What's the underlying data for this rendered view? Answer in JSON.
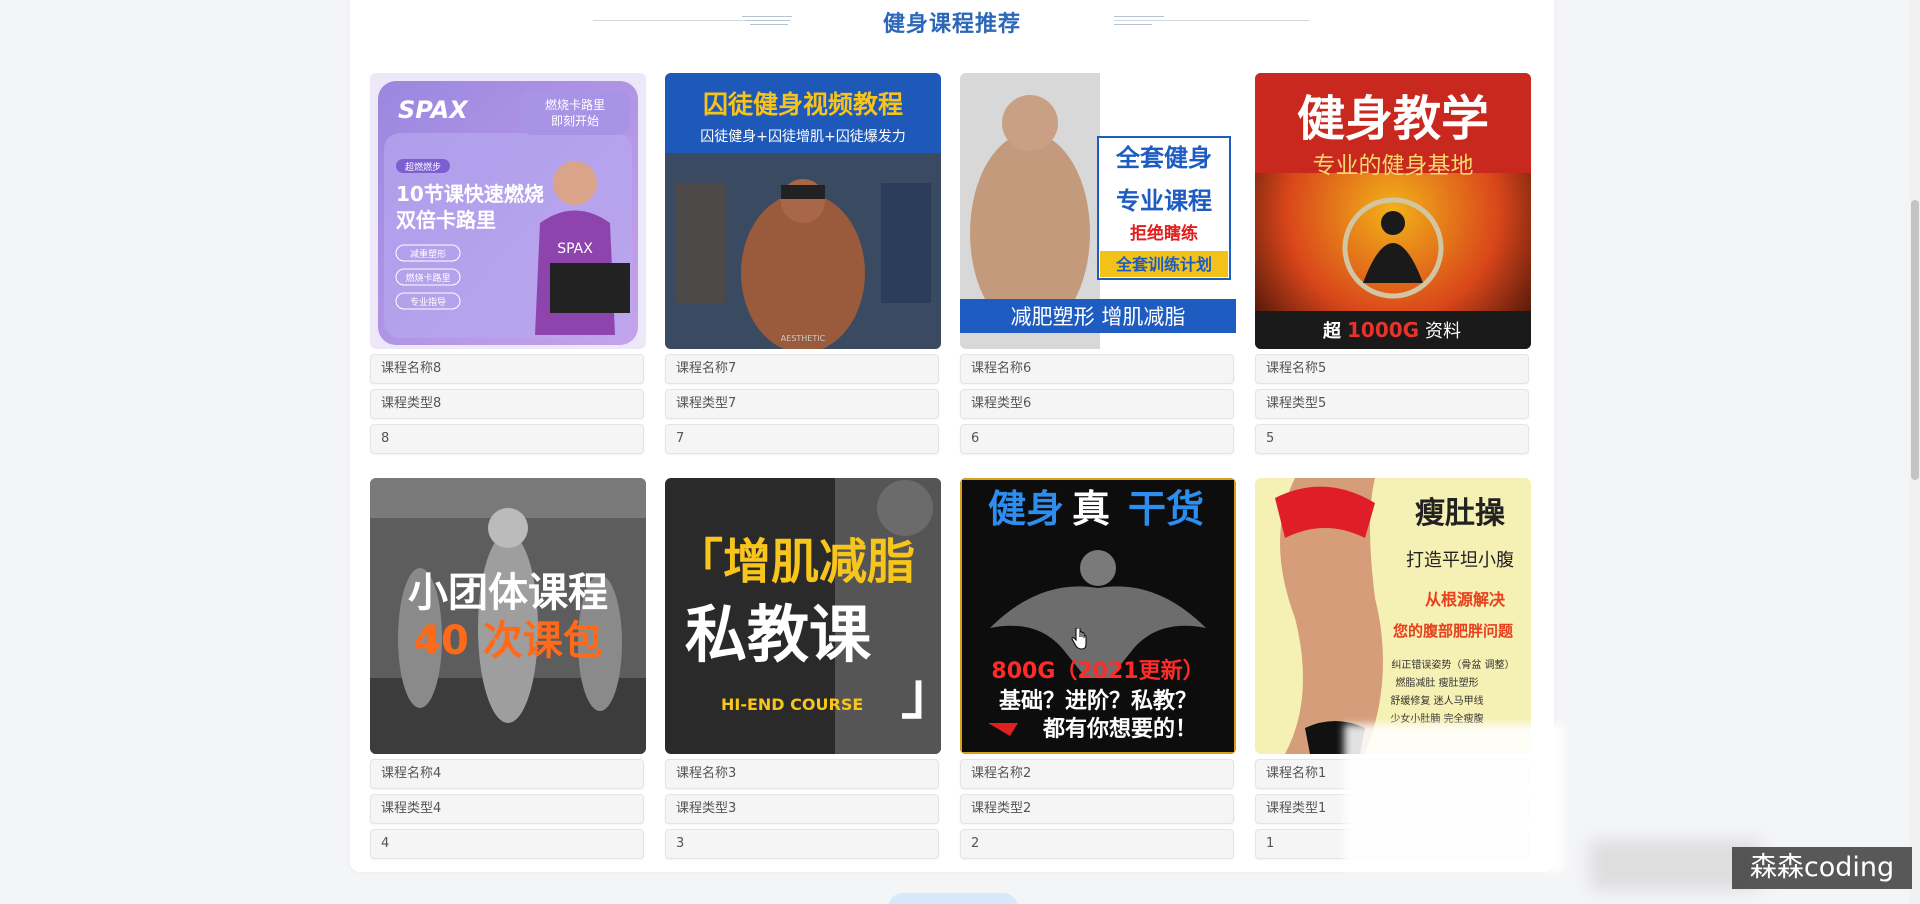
{
  "section": {
    "title": "健身课程推荐"
  },
  "courses": [
    {
      "name": "课程名称8",
      "type": "课程类型8",
      "value": "8",
      "image": {
        "style": "purple",
        "lines": [
          "SPAX",
          "燃烧卡路里",
          "即刻开始",
          "超燃燃步",
          "10节课快速燃烧",
          "双倍卡路里",
          "减重塑形",
          "燃烧卡路里",
          "专业指导",
          "SPAX"
        ]
      }
    },
    {
      "name": "课程名称7",
      "type": "课程类型7",
      "value": "7",
      "image": {
        "style": "blue-gym",
        "lines": [
          "囚徒健身视频教程",
          "囚徒健身+囚徒增肌+囚徒爆发力",
          "AESTHETIC"
        ]
      }
    },
    {
      "name": "课程名称6",
      "type": "课程类型6",
      "value": "6",
      "image": {
        "style": "white-blue",
        "lines": [
          "全套健身",
          "专业课程",
          "拒绝瞎练",
          "全套训练计划",
          "减肥塑形  增肌减脂"
        ]
      }
    },
    {
      "name": "课程名称5",
      "type": "课程类型5",
      "value": "5",
      "image": {
        "style": "red-gold",
        "lines": [
          "健身教学",
          "专业的健身基地",
          "超",
          "1000G",
          "资料"
        ]
      }
    },
    {
      "name": "课程名称4",
      "type": "课程类型4",
      "value": "4",
      "image": {
        "style": "gray-class",
        "lines": [
          "小团体课程",
          "40 次课包"
        ]
      }
    },
    {
      "name": "课程名称3",
      "type": "课程类型3",
      "value": "3",
      "image": {
        "style": "dark-private",
        "lines": [
          "「增肌减脂",
          "私教课",
          "HI-END  COURSE",
          "」"
        ]
      }
    },
    {
      "name": "课程名称2",
      "type": "课程类型2",
      "value": "2",
      "image": {
        "style": "black-muscle",
        "lines": [
          "健身",
          "真",
          "干货",
          "800G（2021更新）",
          "基础？进阶？私教？",
          "都有你想要的！"
        ]
      }
    },
    {
      "name": "课程名称1",
      "type": "课程类型1",
      "value": "1",
      "image": {
        "style": "yellow-abs",
        "lines": [
          "瘦肚操",
          "打造平坦小腹",
          "从根源解决",
          "您的腹部肥胖问题",
          "纠正错误姿势（骨盆 调整）",
          "燃脂减肚 瘦肚塑形",
          "舒缓修复 迷人马甲线",
          "少女小肚腩 完全瘦腹"
        ]
      }
    }
  ],
  "watermark": {
    "text": "森森coding"
  },
  "colors": {
    "title": "#2d67b7",
    "panel": "#ffffff",
    "background": "#f4f5f7"
  }
}
